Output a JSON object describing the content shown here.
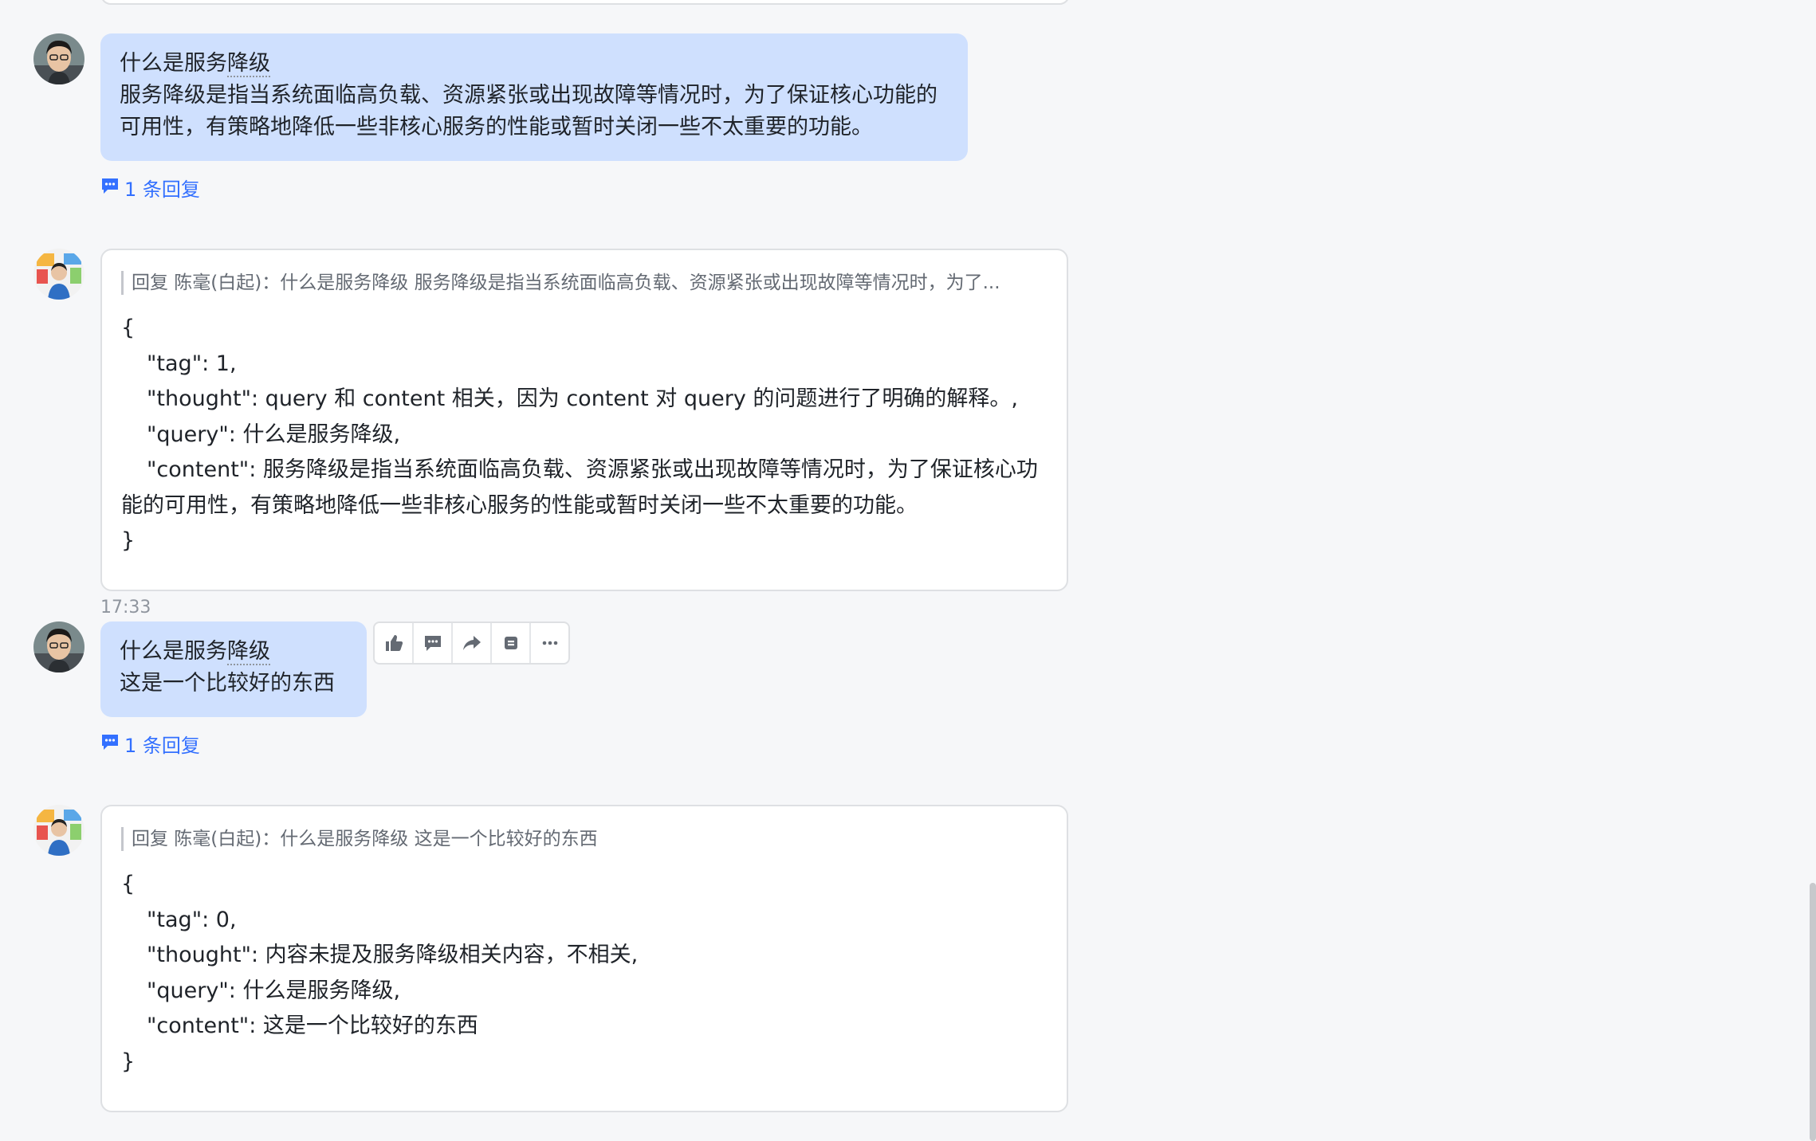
{
  "messages": [
    {
      "title": "什么是服务降级",
      "title_prefix": "什么是服务",
      "title_underlined": "降级",
      "body": "服务降级是指当系统面临高负载、资源紧张或出现故障等情况时，为了保证核心功能的可用性，有策略地降低一些非核心服务的性能或暂时关闭一些不太重要的功能。",
      "reply_count_label": "1 条回复"
    },
    {
      "quote": "回复 陈毫(白起)：什么是服务降级 服务降级是指当系统面临高负载、资源紧张或出现故障等情况时，为了...",
      "json_lines": [
        "{",
        "\"tag\": 1,",
        "\"thought\": query 和 content 相关，因为 content 对 query 的问题进行了明确的解释。,",
        "\"query\": 什么是服务降级,",
        "\"content\": 服务降级是指当系统面临高负载、资源紧张或出现故障等情况时，为了保证核心功能的可用性，有策略地降低一些非核心服务的性能或暂时关闭一些不太重要的功能。",
        "}"
      ]
    },
    {
      "timestamp": "17:33",
      "title_prefix": "什么是服务",
      "title_underlined": "降级",
      "body": "这是一个比较好的东西",
      "reply_count_label": "1 条回复"
    },
    {
      "quote": "回复 陈毫(白起)：什么是服务降级 这是一个比较好的东西",
      "json_lines": [
        "{",
        "\"tag\": 0,",
        "\"thought\": 内容未提及服务降级相关内容，不相关,",
        "\"query\": 什么是服务降级,",
        "\"content\": 这是一个比较好的东西",
        "}"
      ]
    }
  ],
  "toolbar_icons": [
    "thumbs-up-icon",
    "comment-icon",
    "forward-icon",
    "pin-icon",
    "more-icon"
  ],
  "colors": {
    "bubble_blue": "#cfe0fe",
    "link_blue": "#3370ff",
    "background": "#f6f7f9"
  }
}
